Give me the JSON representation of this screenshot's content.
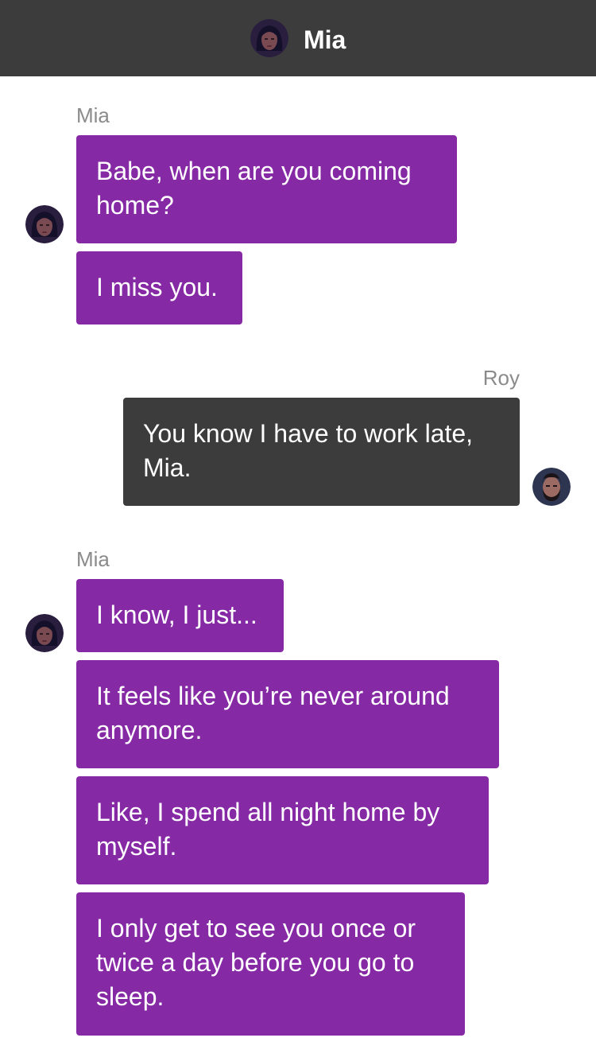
{
  "header": {
    "title": "Mia"
  },
  "colors": {
    "mia_bubble": "#8629a5",
    "roy_bubble": "#3c3c3c",
    "header_bg": "#3c3c3c",
    "sender_label": "#8b8b8b"
  },
  "thread": [
    {
      "sender": "Mia",
      "messages": [
        "Babe, when are you coming home?",
        "I miss you."
      ]
    },
    {
      "sender": "Roy",
      "messages": [
        "You know I have to work late, Mia."
      ]
    },
    {
      "sender": "Mia",
      "messages": [
        "I know, I just...",
        "It feels like you’re never around anymore.",
        "Like, I spend all night home by myself.",
        "I only get to see you once or twice a day before you go to sleep."
      ]
    }
  ]
}
